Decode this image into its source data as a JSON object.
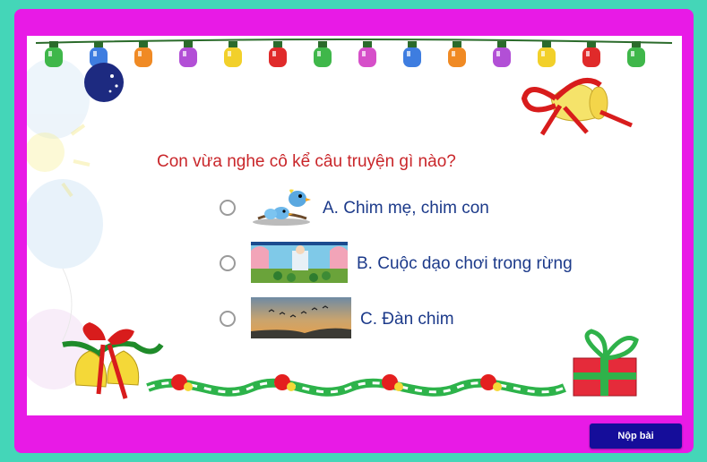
{
  "quiz": {
    "question": "Con vừa nghe cô kể câu truyện gì nào?",
    "options": [
      {
        "label": "A. Chim mẹ, chim con",
        "image_icon": "bird-icon",
        "selected": false
      },
      {
        "label": "B. Cuộc dạo chơi trong rừng",
        "image_icon": "forest-stage-icon",
        "selected": false
      },
      {
        "label": "C. Đàn chim",
        "image_icon": "flock-of-birds-icon",
        "selected": false
      }
    ]
  },
  "footer": {
    "submit_label": "Nộp bài"
  },
  "colors": {
    "page_bg": "#44d6b8",
    "frame": "#e81ae6",
    "question_text": "#c9262a",
    "option_text": "#1c3a8a",
    "submit_bg": "#150d9a"
  }
}
